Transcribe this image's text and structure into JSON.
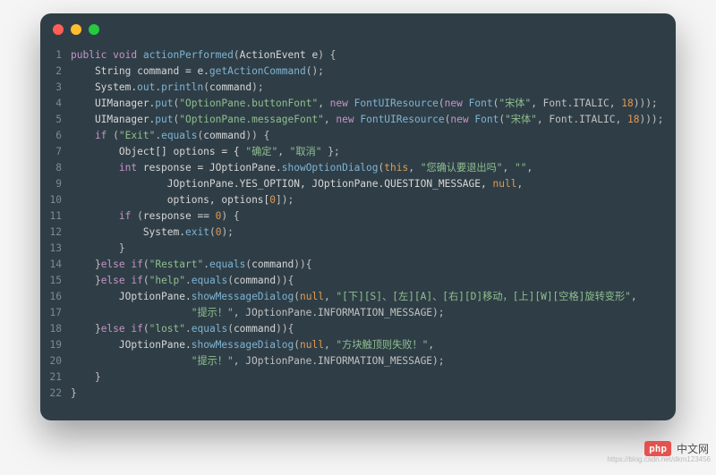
{
  "watermark": {
    "logo": "php",
    "text": "中文网",
    "url": "https://blog.csdn.net/dkm123456"
  },
  "code": {
    "lines": [
      [
        [
          "kw",
          "public "
        ],
        [
          "kw",
          "void "
        ],
        [
          "mth",
          "actionPerformed"
        ],
        [
          "pun",
          "("
        ],
        [
          "id",
          "ActionEvent e"
        ],
        [
          "pun",
          ") {"
        ]
      ],
      [
        [
          "id",
          "    String command = e."
        ],
        [
          "mth",
          "getActionCommand"
        ],
        [
          "pun",
          "();"
        ]
      ],
      [
        [
          "id",
          "    System."
        ],
        [
          "mth",
          "out"
        ],
        [
          "pun",
          "."
        ],
        [
          "mth",
          "println"
        ],
        [
          "pun",
          "("
        ],
        [
          "id",
          "command"
        ],
        [
          "pun",
          ");"
        ]
      ],
      [
        [
          "id",
          "    UIManager."
        ],
        [
          "mth",
          "put"
        ],
        [
          "pun",
          "("
        ],
        [
          "str",
          "\"OptionPane.buttonFont\""
        ],
        [
          "pun",
          ", "
        ],
        [
          "kw",
          "new "
        ],
        [
          "mth",
          "FontUIResource"
        ],
        [
          "pun",
          "("
        ],
        [
          "kw",
          "new "
        ],
        [
          "mth",
          "Font"
        ],
        [
          "pun",
          "("
        ],
        [
          "str",
          "\"宋体\""
        ],
        [
          "pun",
          ", Font.ITALIC, "
        ],
        [
          "num",
          "18"
        ],
        [
          "pun",
          ")));"
        ]
      ],
      [
        [
          "id",
          "    UIManager."
        ],
        [
          "mth",
          "put"
        ],
        [
          "pun",
          "("
        ],
        [
          "str",
          "\"OptionPane.messageFont\""
        ],
        [
          "pun",
          ", "
        ],
        [
          "kw",
          "new "
        ],
        [
          "mth",
          "FontUIResource"
        ],
        [
          "pun",
          "("
        ],
        [
          "kw",
          "new "
        ],
        [
          "mth",
          "Font"
        ],
        [
          "pun",
          "("
        ],
        [
          "str",
          "\"宋体\""
        ],
        [
          "pun",
          ", Font.ITALIC, "
        ],
        [
          "num",
          "18"
        ],
        [
          "pun",
          ")));"
        ]
      ],
      [
        [
          "kw",
          "    if "
        ],
        [
          "pun",
          "("
        ],
        [
          "str",
          "\"Exit\""
        ],
        [
          "pun",
          "."
        ],
        [
          "mth",
          "equals"
        ],
        [
          "pun",
          "("
        ],
        [
          "id",
          "command"
        ],
        [
          "pun",
          ")) {"
        ]
      ],
      [
        [
          "id",
          "        Object[] options = { "
        ],
        [
          "str",
          "\"确定\""
        ],
        [
          "pun",
          ", "
        ],
        [
          "str",
          "\"取消\""
        ],
        [
          "pun",
          " };"
        ]
      ],
      [
        [
          "kw",
          "        int "
        ],
        [
          "id",
          "response = JOptionPane."
        ],
        [
          "mth",
          "showOptionDialog"
        ],
        [
          "pun",
          "("
        ],
        [
          "thi",
          "this"
        ],
        [
          "pun",
          ", "
        ],
        [
          "str",
          "\"您确认要退出吗\""
        ],
        [
          "pun",
          ", "
        ],
        [
          "str",
          "\"\""
        ],
        [
          "pun",
          ","
        ]
      ],
      [
        [
          "id",
          "                JOptionPane.YES_OPTION, JOptionPane.QUESTION_MESSAGE, "
        ],
        [
          "nul",
          "null"
        ],
        [
          "pun",
          ","
        ]
      ],
      [
        [
          "id",
          "                options, options["
        ],
        [
          "num",
          "0"
        ],
        [
          "pun",
          "]);"
        ]
      ],
      [
        [
          "kw",
          "        if "
        ],
        [
          "pun",
          "("
        ],
        [
          "id",
          "response == "
        ],
        [
          "num",
          "0"
        ],
        [
          "pun",
          ") {"
        ]
      ],
      [
        [
          "id",
          "            System."
        ],
        [
          "mth",
          "exit"
        ],
        [
          "pun",
          "("
        ],
        [
          "num",
          "0"
        ],
        [
          "pun",
          ");"
        ]
      ],
      [
        [
          "pun",
          "        }"
        ]
      ],
      [
        [
          "pun",
          "    }"
        ],
        [
          "kw",
          "else if"
        ],
        [
          "pun",
          "("
        ],
        [
          "str",
          "\"Restart\""
        ],
        [
          "pun",
          "."
        ],
        [
          "mth",
          "equals"
        ],
        [
          "pun",
          "("
        ],
        [
          "id",
          "command"
        ],
        [
          "pun",
          ")){"
        ]
      ],
      [
        [
          "pun",
          "    }"
        ],
        [
          "kw",
          "else if"
        ],
        [
          "pun",
          "("
        ],
        [
          "str",
          "\"help\""
        ],
        [
          "pun",
          "."
        ],
        [
          "mth",
          "equals"
        ],
        [
          "pun",
          "("
        ],
        [
          "id",
          "command"
        ],
        [
          "pun",
          ")){"
        ]
      ],
      [
        [
          "id",
          "        JOptionPane."
        ],
        [
          "mth",
          "showMessageDialog"
        ],
        [
          "pun",
          "("
        ],
        [
          "nul",
          "null"
        ],
        [
          "pun",
          ", "
        ],
        [
          "str",
          "\"[下][S]、[左][A]、[右][D]移动，[上][W][空格]旋转变形\""
        ],
        [
          "pun",
          ","
        ]
      ],
      [
        [
          "id",
          "                    "
        ],
        [
          "str",
          "\"提示！\""
        ],
        [
          "pun",
          ", JOptionPane.INFORMATION_MESSAGE);"
        ]
      ],
      [
        [
          "pun",
          "    }"
        ],
        [
          "kw",
          "else if"
        ],
        [
          "pun",
          "("
        ],
        [
          "str",
          "\"lost\""
        ],
        [
          "pun",
          "."
        ],
        [
          "mth",
          "equals"
        ],
        [
          "pun",
          "("
        ],
        [
          "id",
          "command"
        ],
        [
          "pun",
          ")){"
        ]
      ],
      [
        [
          "id",
          "        JOptionPane."
        ],
        [
          "mth",
          "showMessageDialog"
        ],
        [
          "pun",
          "("
        ],
        [
          "nul",
          "null"
        ],
        [
          "pun",
          ", "
        ],
        [
          "str",
          "\"方块触顶则失败！\""
        ],
        [
          "pun",
          ","
        ]
      ],
      [
        [
          "id",
          "                    "
        ],
        [
          "str",
          "\"提示！\""
        ],
        [
          "pun",
          ", JOptionPane.INFORMATION_MESSAGE);"
        ]
      ],
      [
        [
          "pun",
          "    }"
        ]
      ],
      [
        [
          "pun",
          "}"
        ]
      ]
    ]
  }
}
